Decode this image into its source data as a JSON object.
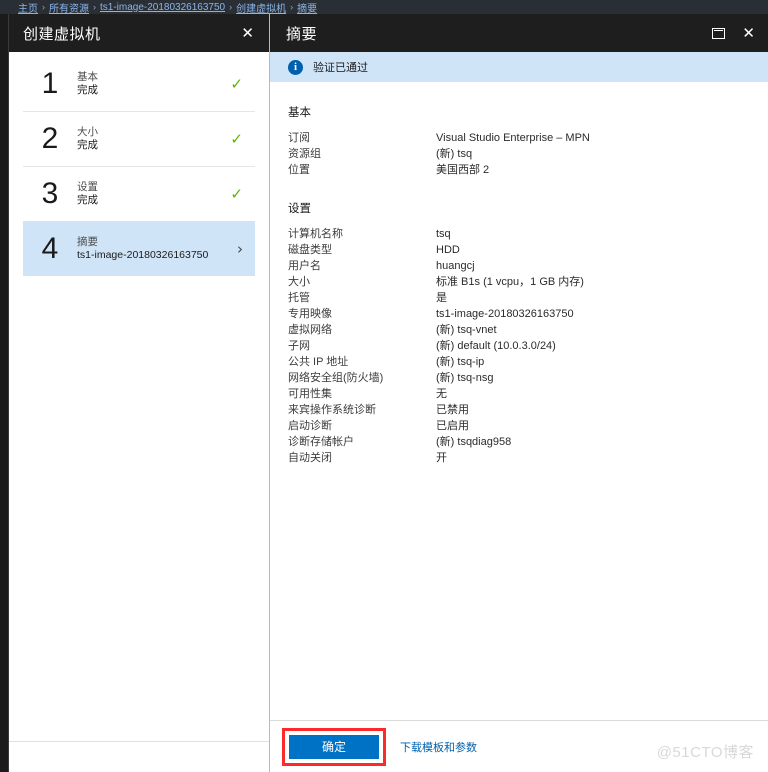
{
  "breadcrumb": {
    "items": [
      "主页",
      "所有资源",
      "ts1-image-20180326163750",
      "创建虚拟机",
      "摘要"
    ],
    "separator": "›"
  },
  "left_blade": {
    "title": "创建虚拟机",
    "close_label": "✕",
    "steps": [
      {
        "num": "1",
        "label": "基本",
        "sub": "完成",
        "status_icon": "✓"
      },
      {
        "num": "2",
        "label": "大小",
        "sub": "完成",
        "status_icon": "✓"
      },
      {
        "num": "3",
        "label": "设置",
        "sub": "完成",
        "status_icon": "✓"
      },
      {
        "num": "4",
        "label": "摘要",
        "sub": "ts1-image-20180326163750",
        "status_icon": "›"
      }
    ]
  },
  "right_blade": {
    "title": "摘要",
    "maximize_label": "",
    "close_label": "✕",
    "validation": {
      "icon_text": "i",
      "message": "验证已通过"
    },
    "sections": [
      {
        "title": "基本",
        "rows": [
          {
            "key": "订阅",
            "value": "Visual Studio Enterprise – MPN"
          },
          {
            "key": "资源组",
            "value": "(新) tsq"
          },
          {
            "key": "位置",
            "value": "美国西部 2"
          }
        ]
      },
      {
        "title": "设置",
        "rows": [
          {
            "key": "计算机名称",
            "value": "tsq"
          },
          {
            "key": "磁盘类型",
            "value": "HDD"
          },
          {
            "key": "用户名",
            "value": "huangcj"
          },
          {
            "key": "大小",
            "value": "标准 B1s (1 vcpu，1 GB 内存)"
          },
          {
            "key": "托管",
            "value": "是"
          },
          {
            "key": "专用映像",
            "value": "ts1-image-20180326163750"
          },
          {
            "key": "虚拟网络",
            "value": "(新) tsq-vnet"
          },
          {
            "key": "子网",
            "value": "(新) default (10.0.3.0/24)"
          },
          {
            "key": "公共 IP 地址",
            "value": "(新) tsq-ip"
          },
          {
            "key": "网络安全组(防火墙)",
            "value": "(新) tsq-nsg"
          },
          {
            "key": "可用性集",
            "value": "无"
          },
          {
            "key": "来宾操作系统诊断",
            "value": "已禁用"
          },
          {
            "key": "启动诊断",
            "value": "已启用"
          },
          {
            "key": "诊断存储帐户",
            "value": "(新) tsqdiag958"
          },
          {
            "key": "自动关闭",
            "value": "开"
          }
        ]
      }
    ],
    "footer": {
      "ok_label": "确定",
      "download_label": "下载模板和参数"
    }
  },
  "watermark": "@51CTO博客",
  "colors": {
    "accent_blue": "#0072c6",
    "link_blue": "#0060ab",
    "check_green": "#5bb600",
    "highlight_red": "#fc2a2a",
    "selected_row": "#cfe4f7",
    "header_dark": "#1e1e1e"
  }
}
